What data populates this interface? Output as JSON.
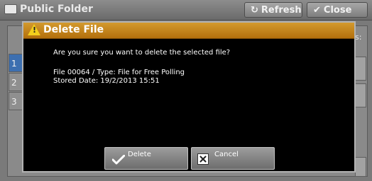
{
  "background": {
    "title": "Public Folder",
    "refresh_label": "Refresh",
    "close_label": "Close",
    "row_tabs": [
      "1",
      "2",
      "3"
    ],
    "right_hint": "s:"
  },
  "dialog": {
    "title": "Delete File",
    "message": "Are you sure you want to delete the selected file?",
    "file_info": "File 00064 / Type: File for Free Polling",
    "stored_date": "Stored Date: 19/2/2013 15:51",
    "delete_label": "Delete",
    "cancel_label": "Cancel"
  },
  "colors": {
    "titlebar": "#c4850f",
    "dialog_bg": "#000000",
    "warning": "#f3cf1c"
  }
}
